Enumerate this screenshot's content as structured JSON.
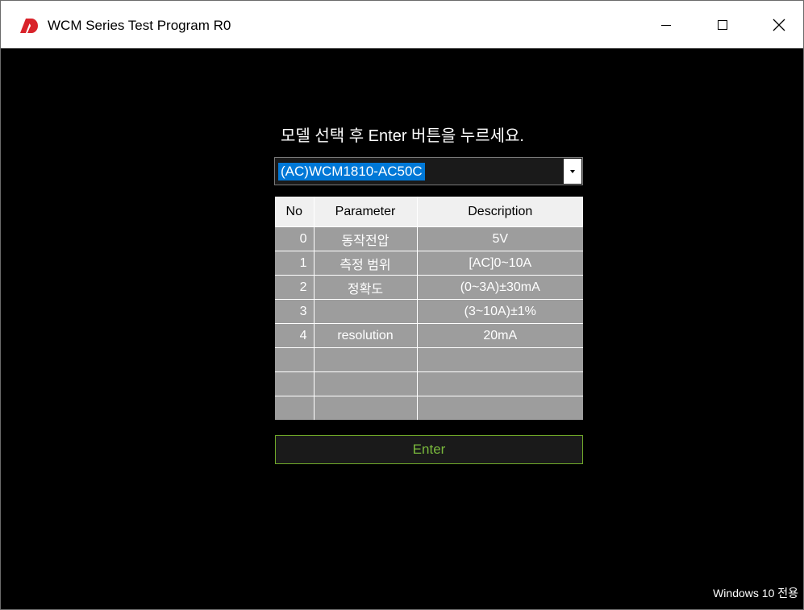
{
  "window": {
    "title": "WCM Series Test Program R0"
  },
  "main": {
    "prompt": "모델 선택 후 Enter 버튼을 누르세요.",
    "model_select": {
      "value": "(AC)WCM1810-AC50C"
    },
    "table": {
      "headers": [
        "No",
        "Parameter",
        "Description"
      ],
      "rows": [
        [
          "0",
          "동작전압",
          "5V"
        ],
        [
          "1",
          "측정 범위",
          "[AC]0~10A"
        ],
        [
          "2",
          "정확도",
          "(0~3A)±30mA"
        ],
        [
          "3",
          "",
          "(3~10A)±1%"
        ],
        [
          "4",
          "resolution",
          "20mA"
        ],
        [
          "",
          "",
          ""
        ],
        [
          "",
          "",
          ""
        ],
        [
          "",
          "",
          ""
        ]
      ]
    },
    "enter_label": "Enter",
    "footer_note": "Windows 10 전용"
  },
  "colors": {
    "accent": "#0078d7",
    "enter_text": "#79b83c",
    "enter_border": "#6fa829",
    "row_bg": "#9d9d9d",
    "brand_icon": "#d9232a"
  },
  "icons": [
    "app-logo-icon",
    "minimize-icon",
    "maximize-icon",
    "close-icon",
    "chevron-down-icon"
  ]
}
